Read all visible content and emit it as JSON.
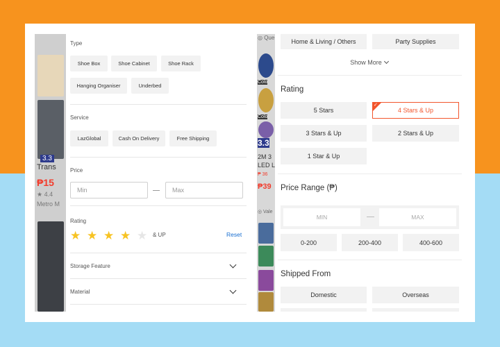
{
  "left_screen": {
    "bg_products": {
      "badge": "3.3",
      "title": "Trans",
      "price": "₱15",
      "rating": "★ 4.4",
      "shop": "Metro M"
    },
    "type": {
      "title": "Type",
      "chips": [
        "Shoe Box",
        "Shoe Cabinet",
        "Shoe Rack",
        "Hanging Organiser",
        "Underbed"
      ]
    },
    "service": {
      "title": "Service",
      "chips": [
        "LazGlobal",
        "Cash On Delivery",
        "Free Shipping"
      ]
    },
    "price": {
      "title": "Price",
      "min_placeholder": "Min",
      "max_placeholder": "Max"
    },
    "rating": {
      "title": "Rating",
      "stars_selected": 4,
      "stars_total": 5,
      "and_up": "& UP",
      "reset_label": "Reset"
    },
    "accordions": [
      "Storage Feature",
      "Material"
    ]
  },
  "right_screen": {
    "bg_products": {
      "t1": "◎ Que",
      "t2": "Colo",
      "t3": "3.3",
      "t4": "2M 3",
      "t5": "LED L",
      "t6": "₱ 36",
      "price": "₱39",
      "t7": "◎ Vale"
    },
    "categories": [
      "Home & Living / Others",
      "Party Supplies"
    ],
    "show_more": "Show More",
    "rating": {
      "title": "Rating",
      "options": [
        "5 Stars",
        "4 Stars & Up",
        "3 Stars & Up",
        "2 Stars & Up",
        "1 Star & Up"
      ],
      "selected": "4 Stars & Up"
    },
    "price_range": {
      "title": "Price Range (₱)",
      "min_placeholder": "MIN",
      "max_placeholder": "MAX",
      "presets": [
        "0-200",
        "200-400",
        "400-600"
      ]
    },
    "shipped_from": {
      "title": "Shipped From",
      "options": [
        "Domestic",
        "Overseas"
      ]
    }
  },
  "colors": {
    "orange_bg": "#f7931e",
    "blue_bg": "#a4dcf5",
    "accent": "#f2552c",
    "star": "#f7c323",
    "link": "#1a6fd1"
  }
}
